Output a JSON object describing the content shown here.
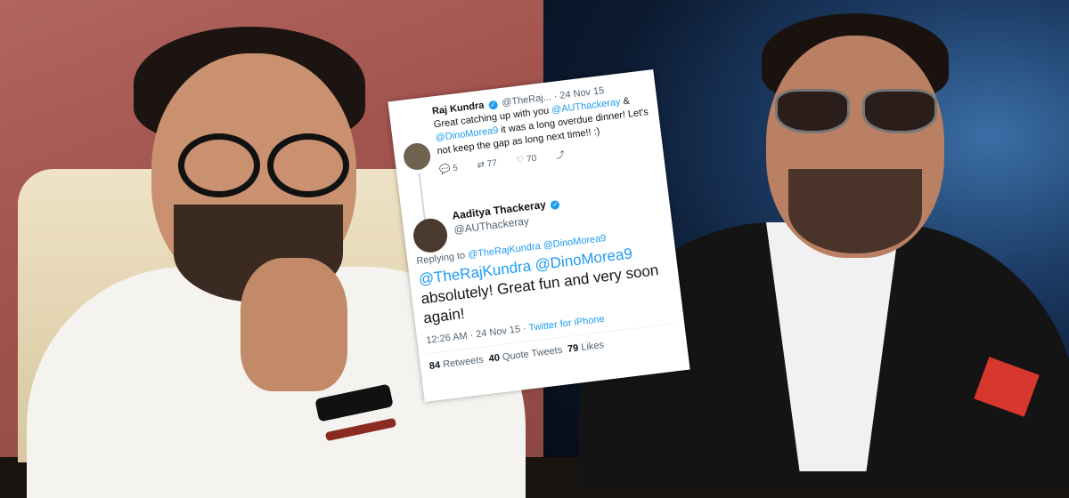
{
  "tweet1": {
    "name": "Raj Kundra",
    "handle": "@TheRaj...",
    "date": "· 24 Nov 15",
    "text_1": "Great catching up with you",
    "mention_a": "@AUThackeray",
    "amp": " & ",
    "mention_b": "@DinoMorea9",
    "text_2": " it was a long overdue dinner! Let's not keep the gap as long next time!! :)",
    "replies": "5",
    "retweets": "77",
    "likes": "70"
  },
  "tweet2": {
    "name": "Aaditya Thackeray",
    "handle": "@AUThackeray",
    "replying_label": "Replying to",
    "replying_mentions": "@TheRajKundra @DinoMorea9",
    "mentions": "@TheRajKundra @DinoMorea9",
    "text": "absolutely! Great fun and very soon again!",
    "time": "12:26 AM · 24 Nov 15 · ",
    "client": "Twitter for iPhone",
    "retweets": "84",
    "retweets_label": "Retweets",
    "quotes": "40",
    "quotes_label": "Quote Tweets",
    "likes": "79",
    "likes_label": "Likes"
  },
  "colors": {
    "twitter_blue": "#1d9bf0",
    "left_wall": "#a3544e",
    "right_stage": "#0c1b32"
  },
  "icons": [
    "verified-icon",
    "reply-icon",
    "retweet-icon",
    "like-icon",
    "share-icon"
  ]
}
